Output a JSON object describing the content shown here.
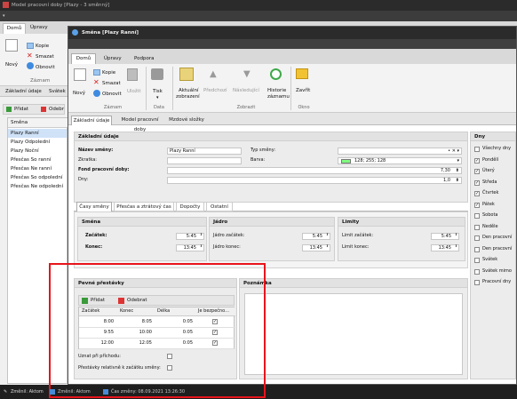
{
  "outer": {
    "title": "Model pracovní doby [Plazy - 3 směnný]",
    "menu": [
      "Domů",
      "Úpravy"
    ],
    "ribbon": {
      "kopie": "Kopie",
      "smazat": "Smazat",
      "obnovit": "Obnovit",
      "novy": "Nový",
      "zaznam": "Záznam"
    },
    "tabs": [
      "Základní údaje",
      "Svátek"
    ],
    "add": "Přidat",
    "remove": "Odebr",
    "list_header": "Směna",
    "items": [
      "Plazy Ranní",
      "Plazy Odpolední",
      "Plazy Noční",
      "Přesčas So ranní",
      "Přesčas Ne ranní",
      "Přesčas So odpolední",
      "Přesčas Ne odpolední"
    ],
    "status": "Změnil: Aktom"
  },
  "inner": {
    "title": "Směna [Plazy Ranní]",
    "menu": [
      "Domů",
      "Úpravy",
      "Podpora"
    ],
    "ribbon": {
      "kopie": "Kopie",
      "smazat": "Smazat",
      "obnovit": "Obnovit",
      "novy": "Nový",
      "ulozit": "Uložit",
      "tisk": "Tisk",
      "aktualni": "Aktuální",
      "zobrazeni": "zobrazení",
      "predchozi": "Předchozí",
      "nasledujici": "Následující",
      "historie": "Historie",
      "historie2": "záznamu",
      "zavrit": "Zavřít",
      "groups": [
        "Záznam",
        "Data",
        "Zobrazit",
        "Okno"
      ]
    },
    "tabs": [
      "Základní údaje",
      "Model pracovní doby",
      "Mzdové složky"
    ],
    "basic": {
      "header": "Základní údaje",
      "nazev_label": "Název směny:",
      "nazev": "Plazy Ranní",
      "typ_label": "Typ směny:",
      "zkratka_label": "Zkratka:",
      "barva_label": "Barva:",
      "barva": "128; 255; 128",
      "barva_color": "#80ff80",
      "fond_label": "Fond pracovní doby:",
      "fond": "7,30",
      "dny_label": "Dny:",
      "dny": "1,0"
    },
    "subtabs": [
      "Časy směny",
      "Přesčas a ztrátový čas",
      "Dopočty",
      "Ostatní"
    ],
    "smena": {
      "header": "Směna",
      "zacatek_label": "Začátek:",
      "zacatek": "5:45",
      "konec_label": "Konec:",
      "konec": "13:45"
    },
    "jadro": {
      "header": "Jádro",
      "zacatek_label": "Jádro začátek:",
      "zacatek": "5:45",
      "konec_label": "Jádro konec:",
      "konec": "13:45"
    },
    "limity": {
      "header": "Limity",
      "zacatek_label": "Limit začátek:",
      "zacatek": "5:45",
      "konec_label": "Limit konec:",
      "konec": "13:45"
    },
    "prestavky": {
      "header": "Pevné přestávky",
      "pridat": "Přidat",
      "odebrat": "Odebrat",
      "columns": [
        "Začátek",
        "Konec",
        "Délka",
        "Je bezpečno..."
      ],
      "rows": [
        {
          "zacatek": "8:00",
          "konec": "8:05",
          "delka": "0:05"
        },
        {
          "zacatek": "9:55",
          "konec": "10:00",
          "delka": "0:05"
        },
        {
          "zacatek": "12:00",
          "konec": "12:05",
          "delka": "0:05"
        }
      ],
      "uznat": "Uznat při příchodu:",
      "relativne": "Přestávky relativně k začátku směny:"
    },
    "poznamka": "Poznámka",
    "dny_panel": {
      "header": "Dny",
      "items": [
        {
          "label": "Všechny dny",
          "checked": false
        },
        {
          "label": "Pondělí",
          "checked": true
        },
        {
          "label": "Úterý",
          "checked": true
        },
        {
          "label": "Středa",
          "checked": true
        },
        {
          "label": "Čtvrtek",
          "checked": true
        },
        {
          "label": "Pátek",
          "checked": true
        },
        {
          "label": "Sobota",
          "checked": false
        },
        {
          "label": "Neděle",
          "checked": false
        },
        {
          "label": "Den pracovní",
          "checked": false
        },
        {
          "label": "Den pracovní",
          "checked": false
        },
        {
          "label": "Svátek",
          "checked": false
        },
        {
          "label": "Svátek mimo",
          "checked": false
        },
        {
          "label": "Pracovní dny",
          "checked": false
        }
      ]
    },
    "status": [
      "Změnil: Aktom",
      "Čas změny: 08.09.2021 13:26:30"
    ]
  },
  "highlight_color": "#e8141b"
}
